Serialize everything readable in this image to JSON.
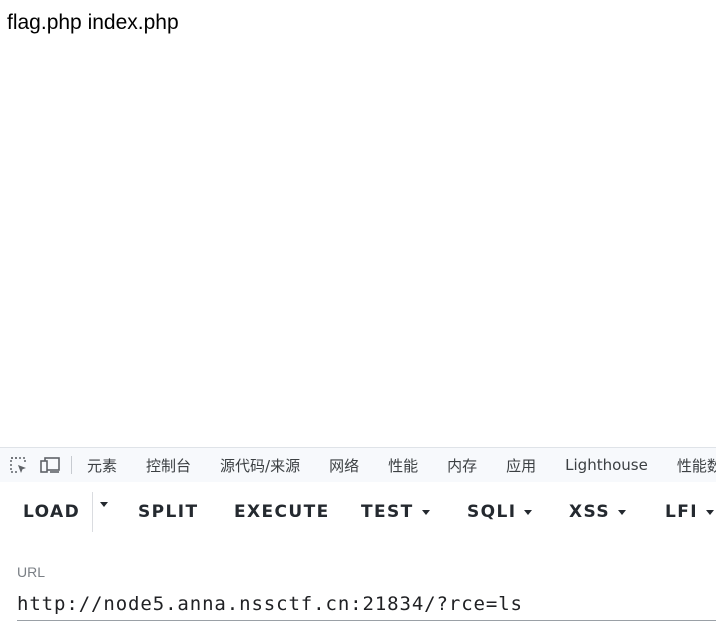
{
  "page": {
    "output_text": "flag.php index.php"
  },
  "devtools": {
    "icons": [
      "inspect-element-icon",
      "device-toolbar-icon"
    ],
    "tabs": [
      "元素",
      "控制台",
      "源代码/来源",
      "网络",
      "性能",
      "内存",
      "应用",
      "Lighthouse",
      "性能数"
    ]
  },
  "hackbar": {
    "buttons": {
      "load": "LOAD",
      "split": "SPLIT",
      "execute": "EXECUTE",
      "test": "TEST",
      "sqli": "SQLI",
      "xss": "XSS",
      "lfi": "LFI"
    },
    "url_label": "URL",
    "url_value": "http://node5.anna.nssctf.cn:21834/?rce=ls"
  },
  "colors": {
    "devtools_bg": "#f7f9fc",
    "button_text": "#24292f",
    "tab_text": "#3c4043"
  }
}
